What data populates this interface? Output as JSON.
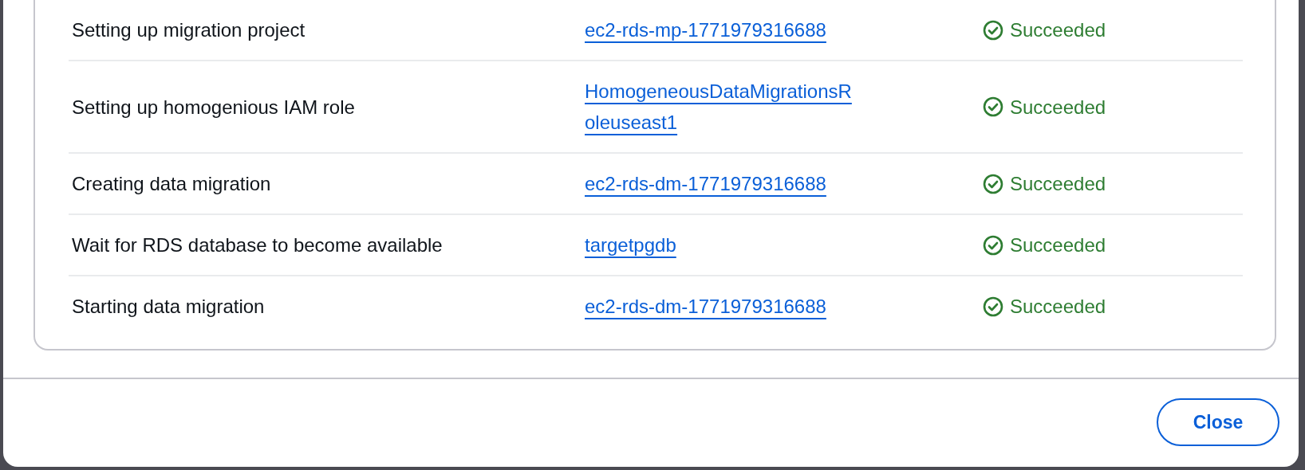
{
  "tasks": [
    {
      "name": "Setting up migration project",
      "resource": "ec2-rds-mp-1771979316688",
      "status": {
        "kind": "succeeded",
        "label": "Succeeded"
      }
    },
    {
      "name": "Setting up homogenious IAM role",
      "resource": "HomogeneousDataMigrationsRoleuseast1",
      "status": {
        "kind": "succeeded",
        "label": "Succeeded"
      }
    },
    {
      "name": "Creating data migration",
      "resource": "ec2-rds-dm-1771979316688",
      "status": {
        "kind": "succeeded",
        "label": "Succeeded"
      }
    },
    {
      "name": "Wait for RDS database to become available",
      "resource": "targetpgdb",
      "status": {
        "kind": "succeeded",
        "label": "Succeeded"
      }
    },
    {
      "name": "Starting data migration",
      "resource": "ec2-rds-dm-1771979316688",
      "status": {
        "kind": "succeeded",
        "label": "Succeeded"
      }
    }
  ],
  "footer": {
    "close_button": {
      "label": "Close"
    }
  }
}
